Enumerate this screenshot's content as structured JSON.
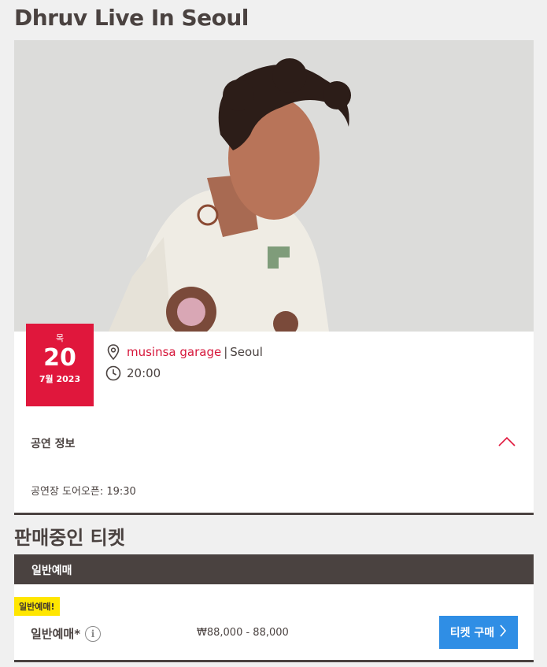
{
  "event": {
    "title": "Dhruv Live In Seoul",
    "hero_image_alt": "Dhruv portrait"
  },
  "date": {
    "day_of_week": "목",
    "day": "20",
    "month_year": "7월 2023"
  },
  "venue": {
    "name": "musinsa garage",
    "separator": "|",
    "city": "Seoul"
  },
  "time": "20:00",
  "info_section": {
    "label": "공연 정보",
    "doors_text": "공연장 도어오픈: 19:30"
  },
  "tickets_section": {
    "title": "판매중인 티켓",
    "tab_label": "일반예매",
    "items": [
      {
        "badge": "일반예매!",
        "name": "일반예매*",
        "price": "₩88,000 - 88,000",
        "button_label": "티켓 구매"
      }
    ]
  },
  "colors": {
    "accent_red": "#e0173c",
    "dark": "#4a4240",
    "button_blue": "#2f8ee5",
    "badge_yellow": "#ffe600"
  }
}
